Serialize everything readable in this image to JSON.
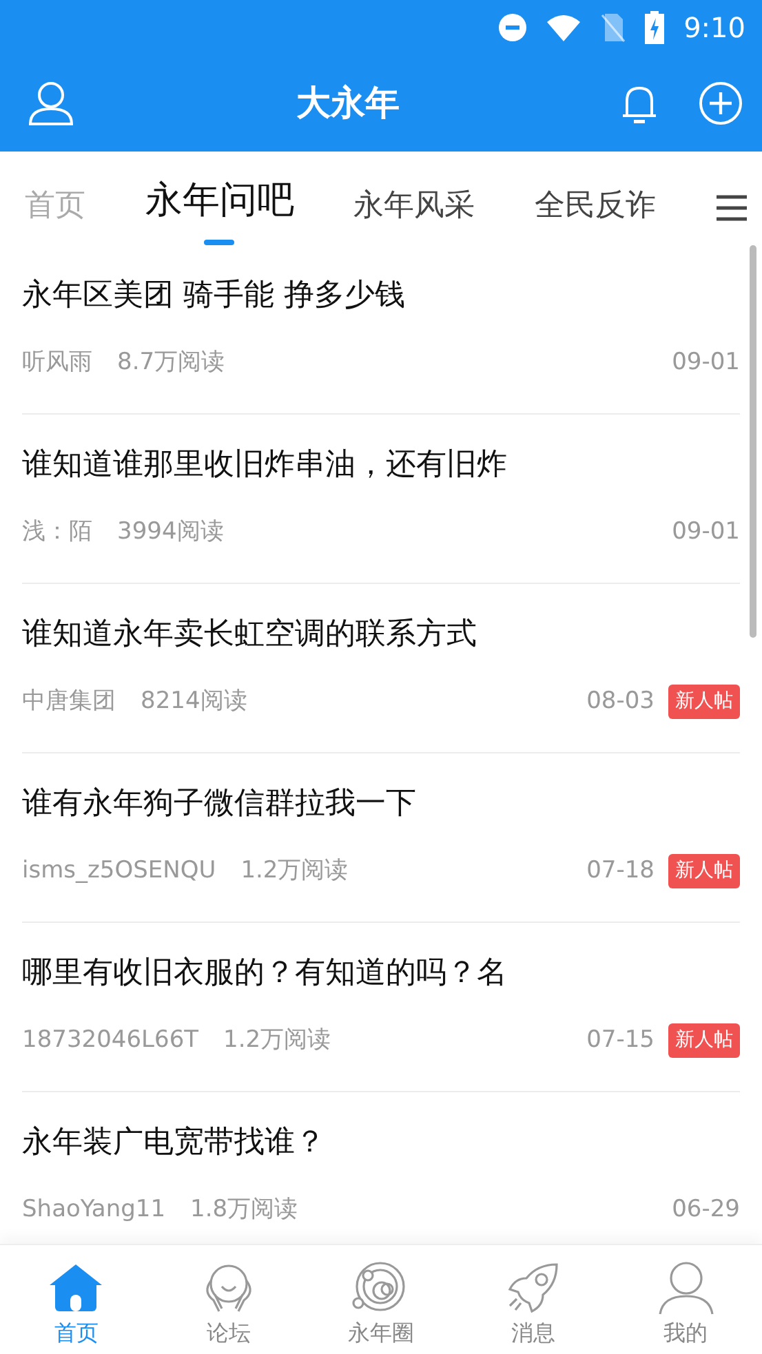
{
  "status_bar": {
    "time": "9:10"
  },
  "app_bar": {
    "title": "大永年"
  },
  "tabs": [
    {
      "label": "首页",
      "selected": false
    },
    {
      "label": "永年问吧",
      "selected": true
    },
    {
      "label": "永年风采",
      "selected": false
    },
    {
      "label": "全民反诈",
      "selected": false
    }
  ],
  "posts": [
    {
      "title": "永年区美团 骑手能 挣多少钱",
      "author": "听风雨",
      "reads": "8.7万阅读",
      "date": "09-01"
    },
    {
      "title": "谁知道谁那里收旧炸串油，还有旧炸",
      "author": "浅：陌",
      "reads": "3994阅读",
      "date": "09-01"
    },
    {
      "title": "谁知道永年卖长虹空调的联系方式",
      "author": "中唐集团",
      "reads": "8214阅读",
      "date": "08-03",
      "badge": "新人帖"
    },
    {
      "title": "谁有永年狗子微信群拉我一下",
      "author": "isms_z5OSENQU",
      "reads": "1.2万阅读",
      "date": "07-18",
      "badge": "新人帖"
    },
    {
      "title": "哪里有收旧衣服的？有知道的吗？名",
      "author": "18732046L66T",
      "reads": "1.2万阅读",
      "date": "07-15",
      "badge": "新人帖"
    },
    {
      "title": "永年装广电宽带找谁？",
      "author": "ShaoYang11",
      "reads": "1.8万阅读",
      "date": "06-29"
    }
  ],
  "bottom_nav": [
    {
      "label": "首页",
      "kind": "home",
      "selected": true
    },
    {
      "label": "论坛",
      "kind": "forum",
      "selected": false
    },
    {
      "label": "永年圈",
      "kind": "orbit",
      "selected": false
    },
    {
      "label": "消息",
      "kind": "rocket",
      "selected": false
    },
    {
      "label": "我的",
      "kind": "person",
      "selected": false
    }
  ]
}
